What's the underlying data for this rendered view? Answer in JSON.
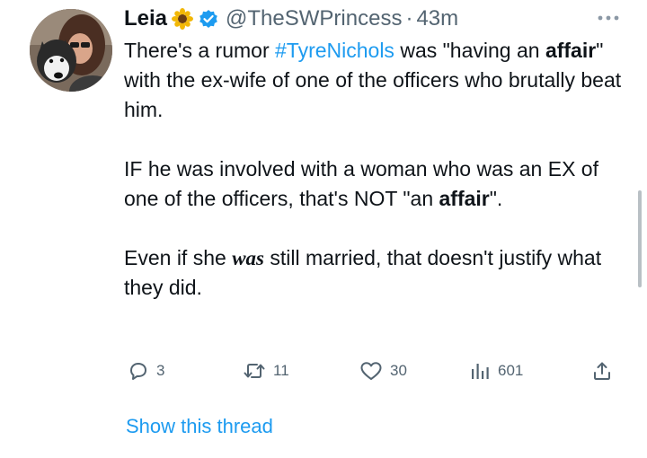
{
  "author": {
    "name": "Leia",
    "emoji_icon": "sunflower-icon",
    "handle": "@TheSWPrincess",
    "separator": "·",
    "time": "43m"
  },
  "tweet": {
    "p1": {
      "t1": "There's a rumor ",
      "hashtag": "#TyreNichols",
      "t2": " was \"having an ",
      "bold": "affair",
      "t3": "\" with the ex-wife of one of the officers who brutally beat him."
    },
    "p2": {
      "t1": "IF he was involved with a woman who was an EX of one of the officers, that's NOT \"an ",
      "bold": "affair",
      "t2": "\"."
    },
    "p3": {
      "t1": "Even if she ",
      "bold_italic": "was",
      "t2": " still married, that doesn't justify what they did."
    }
  },
  "actions": {
    "replies": "3",
    "retweets": "11",
    "likes": "30",
    "views": "601"
  },
  "show_thread": "Show this thread",
  "colors": {
    "accent": "#1d9bf0",
    "text": "#0f1419",
    "secondary": "#536471"
  }
}
